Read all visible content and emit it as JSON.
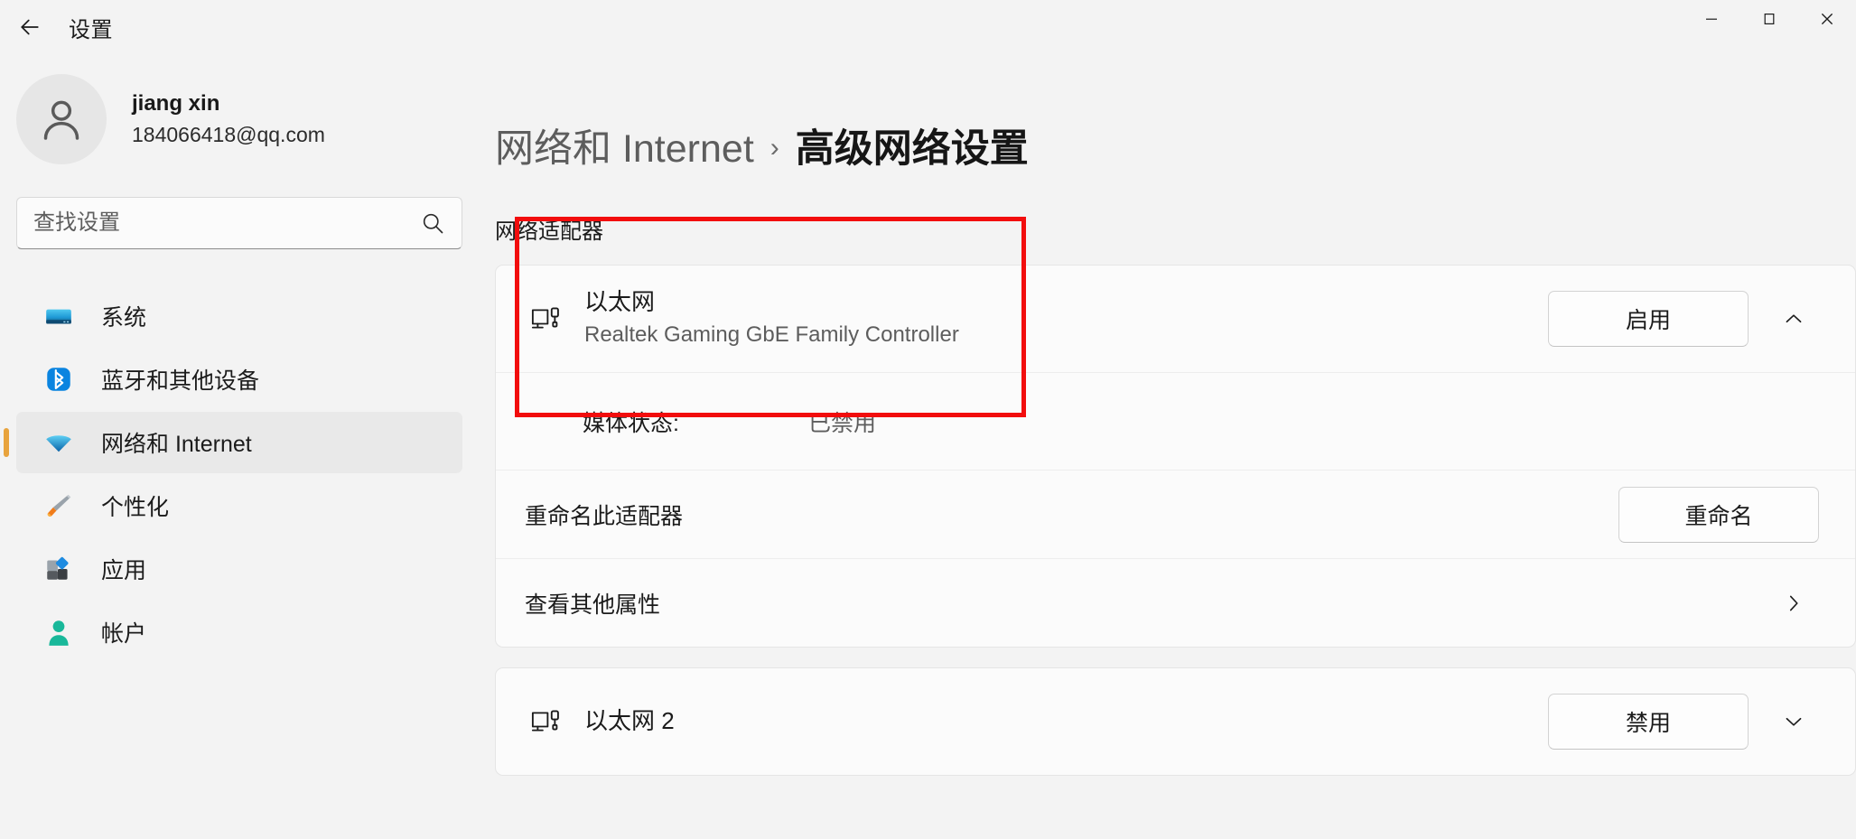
{
  "window": {
    "title": "设置",
    "back_icon": "arrow-left-icon",
    "controls": {
      "minimize": "—",
      "maximize": "▢",
      "close": "✕"
    }
  },
  "account": {
    "name": "jiang xin",
    "email": "184066418@qq.com",
    "avatar_icon": "person-icon"
  },
  "search": {
    "placeholder": "查找设置",
    "value": "",
    "icon": "search-icon"
  },
  "sidebar": {
    "items": [
      {
        "label": "系统",
        "icon": "system-monitor-icon",
        "selected": false
      },
      {
        "label": "蓝牙和其他设备",
        "icon": "bluetooth-icon",
        "selected": false
      },
      {
        "label": "网络和 Internet",
        "icon": "wifi-icon",
        "selected": true
      },
      {
        "label": "个性化",
        "icon": "paintbrush-icon",
        "selected": false
      },
      {
        "label": "应用",
        "icon": "apps-icon",
        "selected": false
      },
      {
        "label": "帐户",
        "icon": "accounts-person-icon",
        "selected": false
      }
    ]
  },
  "breadcrumb": {
    "parent": "网络和 Internet",
    "separator": "›",
    "current": "高级网络设置"
  },
  "main": {
    "section_label": "网络适配器",
    "adapters": [
      {
        "name": "以太网",
        "description": "Realtek Gaming GbE Family Controller",
        "icon": "ethernet-adapter-icon",
        "action_label": "启用",
        "expand_icon": "chevron-up-icon",
        "expanded": true,
        "details": [
          {
            "key": "媒体状态:",
            "value": "已禁用"
          }
        ],
        "links": [
          {
            "label": "重命名此适配器",
            "action_label": "重命名",
            "type": "button"
          },
          {
            "label": "查看其他属性",
            "action_label": "",
            "type": "chevron",
            "icon": "chevron-right-icon"
          }
        ]
      },
      {
        "name": "以太网 2",
        "description": "",
        "icon": "ethernet-adapter-icon",
        "action_label": "禁用",
        "expand_icon": "chevron-down-icon",
        "expanded": false,
        "details": [],
        "links": []
      }
    ]
  },
  "annotation": {
    "color": "#f20d0d",
    "label": "highlight-ethernet-disabled-status"
  }
}
